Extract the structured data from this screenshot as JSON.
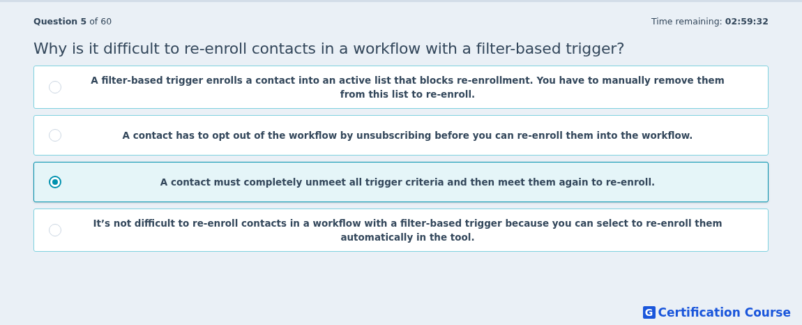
{
  "header": {
    "progress": "**Question 5** of 60",
    "timer_label": "Time remaining:",
    "timer_value": "02:59:32"
  },
  "question": "Why is it difficult to re-enroll contacts in a workflow with a filter-based trigger?",
  "options": [
    {
      "text": "A filter-based trigger enrolls a contact into an active list that blocks re-enrollment. You have to manually remove them from this list to re-enroll.",
      "selected": false
    },
    {
      "text": "A contact has to opt out of the workflow by unsubscribing before you can re-enroll them into the workflow.",
      "selected": false
    },
    {
      "text": "A contact must completely unmeet all trigger criteria and then meet them again to re-enroll.",
      "selected": true
    },
    {
      "text": "It’s not difficult to re-enroll contacts in a workflow with a filter-based trigger because you can select to re-enroll them automatically in the tool.",
      "selected": false
    }
  ],
  "brand": {
    "mark": "G",
    "name": "Certification Course"
  }
}
